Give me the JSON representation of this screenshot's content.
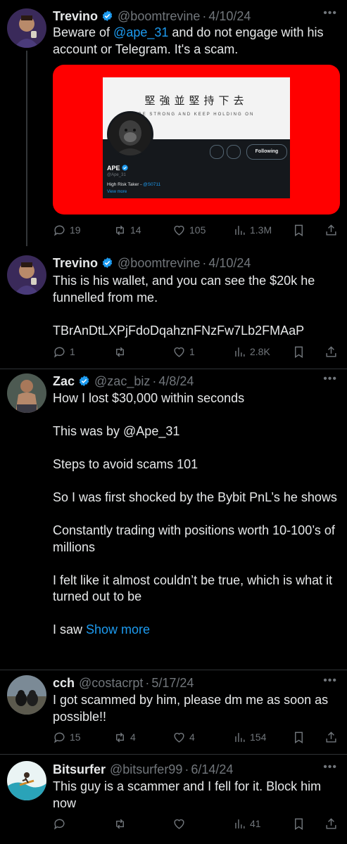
{
  "posts": [
    {
      "name": "Trevino",
      "verified": true,
      "handle": "@boomtrevine",
      "date": "4/10/24",
      "text_before": "Beware of ",
      "mention": "@ape_31",
      "text_after": " and do not engage with his account or Telegram. It's a scam.",
      "media": {
        "banner_title": "堅強並堅持下去",
        "banner_sub": "BE STRONG AND KEEP HOLDING ON",
        "profile_name": "APE",
        "profile_handle": "@Ape_31",
        "bio_text": "High Risk Taker - ",
        "bio_link": "@S0711",
        "view_more": "View more",
        "follow_button": "Following"
      },
      "replies": "19",
      "reposts": "14",
      "likes": "105",
      "views": "1.3M"
    },
    {
      "name": "Trevino",
      "verified": true,
      "handle": "@boomtrevine",
      "date": "4/10/24",
      "text": "This is his wallet, and you can see the $20k he funnelled from me.\n\nTBrAnDtLXPjFdoDqahznFNzFw7Lb2FMAaP",
      "replies": "1",
      "reposts": "",
      "likes": "1",
      "views": "2.8K"
    },
    {
      "name": "Zac",
      "verified": true,
      "handle": "@zac_biz",
      "date": "4/8/24",
      "text": "How I lost $30,000 within seconds\n\nThis was by @Ape_31\n\nSteps to avoid scams 101\n\nSo I was first shocked by the Bybit PnL’s he shows\n\nConstantly trading with positions worth 10-100’s of millions\n\nI felt like it almost couldn’t be true, which is what it turned out to be\n\nI saw ",
      "show_more": "Show more"
    },
    {
      "name": "cch",
      "verified": false,
      "handle": "@costacrpt",
      "date": "5/17/24",
      "text": "I got scammed by him, please dm me as soon as possible!!",
      "replies": "15",
      "reposts": "4",
      "likes": "4",
      "views": "154"
    },
    {
      "name": "Bitsurfer",
      "verified": false,
      "handle": "@bitsurfer99",
      "date": "6/14/24",
      "text": "This guy is a scammer and I fell for it. Block him now",
      "replies": "",
      "reposts": "",
      "likes": "",
      "views": "41"
    }
  ],
  "colors": {
    "background": "#000000",
    "link": "#1d9bf0",
    "verified": "#1d9bf0",
    "secondary_text": "#71767b",
    "media_background": "#ff0000"
  }
}
